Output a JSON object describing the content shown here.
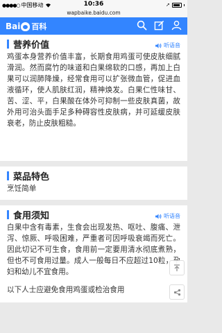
{
  "status": {
    "carrier": "中国移动",
    "time": "10:36",
    "signal_icon": "signal-dots-icon",
    "wifi_icon": "wifi-icon"
  },
  "url": "wapbaike.baidu.com",
  "header": {
    "logo_text": "Bai",
    "logo_suffix": "百科",
    "icons": [
      "search-icon",
      "edit-icon",
      "user-icon"
    ]
  },
  "sections": [
    {
      "title": "营养价值",
      "listen": "听语音",
      "text": "鸡蛋本身营养价值丰富，长期食用鸡蛋可使皮肤细腻滑润。然而腐竹的味道和白果绵软的口感，再加上白果可以润肺降燥，经常食用可以扩张微血管，促进血液循环，使人肌肤红润，精神焕发。白果仁性味甘、苦、涩、平，白果酸在体外可抑制一些皮肤真菌，故外用可治头面手足多种碍容性皮肤病，并可延缓皮肤衰老，防止皮肤粗糙。"
    },
    {
      "title": "菜品特色",
      "text": "烹饪简单"
    },
    {
      "title": "食用须知",
      "listen": "听语音",
      "text": "白果中含有毒素，生食会出现发热、呕吐、腹痛、泄泻、惊厥、呼吸困难，严重者可因呼吸衰竭而死亡。因此切记不可生食，食用前一定要用清水彻底煮熟，但也不可食用过量。成人一般每日不应超过10粒，孕妇和幼儿不宜食用。",
      "extra": "以下人士应避免食用鸡蛋或检治食用"
    }
  ],
  "floating": {
    "up_icon": "back-to-top-icon"
  }
}
